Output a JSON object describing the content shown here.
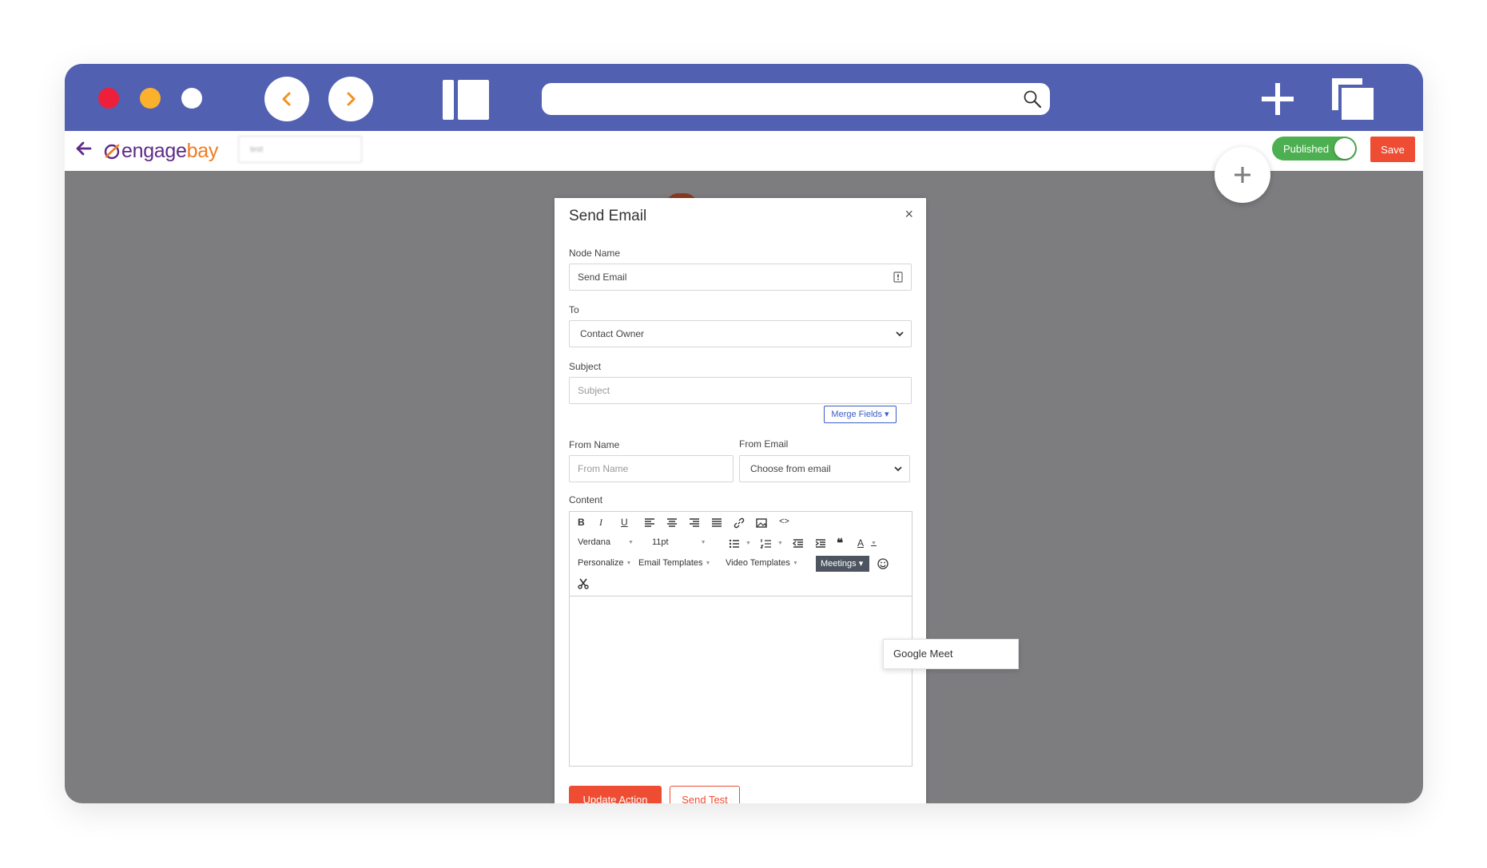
{
  "colors": {
    "chrome": "#5260b1",
    "brand_purple": "#5f2b86",
    "brand_orange": "#f07b21",
    "accent_red": "#ee4d33",
    "published_green": "#4caf50",
    "canvas": "#7d7d80"
  },
  "header": {
    "logo_engage": "engage",
    "logo_bay": "bay",
    "workflow_name": "test",
    "status_label": "Published",
    "save_label": "Save"
  },
  "modal": {
    "title": "Send Email",
    "close_glyph": "×",
    "node_name": {
      "label": "Node Name",
      "value": "Send Email"
    },
    "to": {
      "label": "To",
      "value": "Contact Owner"
    },
    "subject": {
      "label": "Subject",
      "placeholder": "Subject"
    },
    "merge_fields": "Merge Fields ▾",
    "from_name": {
      "label": "From Name",
      "placeholder": "From Name"
    },
    "from_email": {
      "label": "From Email",
      "value": "Choose from email"
    },
    "content_label": "Content",
    "toolbar": {
      "bold": "B",
      "italic": "I",
      "underline": "U",
      "font": "Verdana",
      "size": "11pt",
      "quote": "❝",
      "text_color": "A",
      "personalize": "Personalize",
      "email_templates": "Email Templates",
      "video_templates": "Video Templates",
      "meetings": "Meetings ▾",
      "code": "<>"
    },
    "dropdown_item": "Google Meet",
    "update_action": "Update Action",
    "send_test": "Send Test"
  }
}
